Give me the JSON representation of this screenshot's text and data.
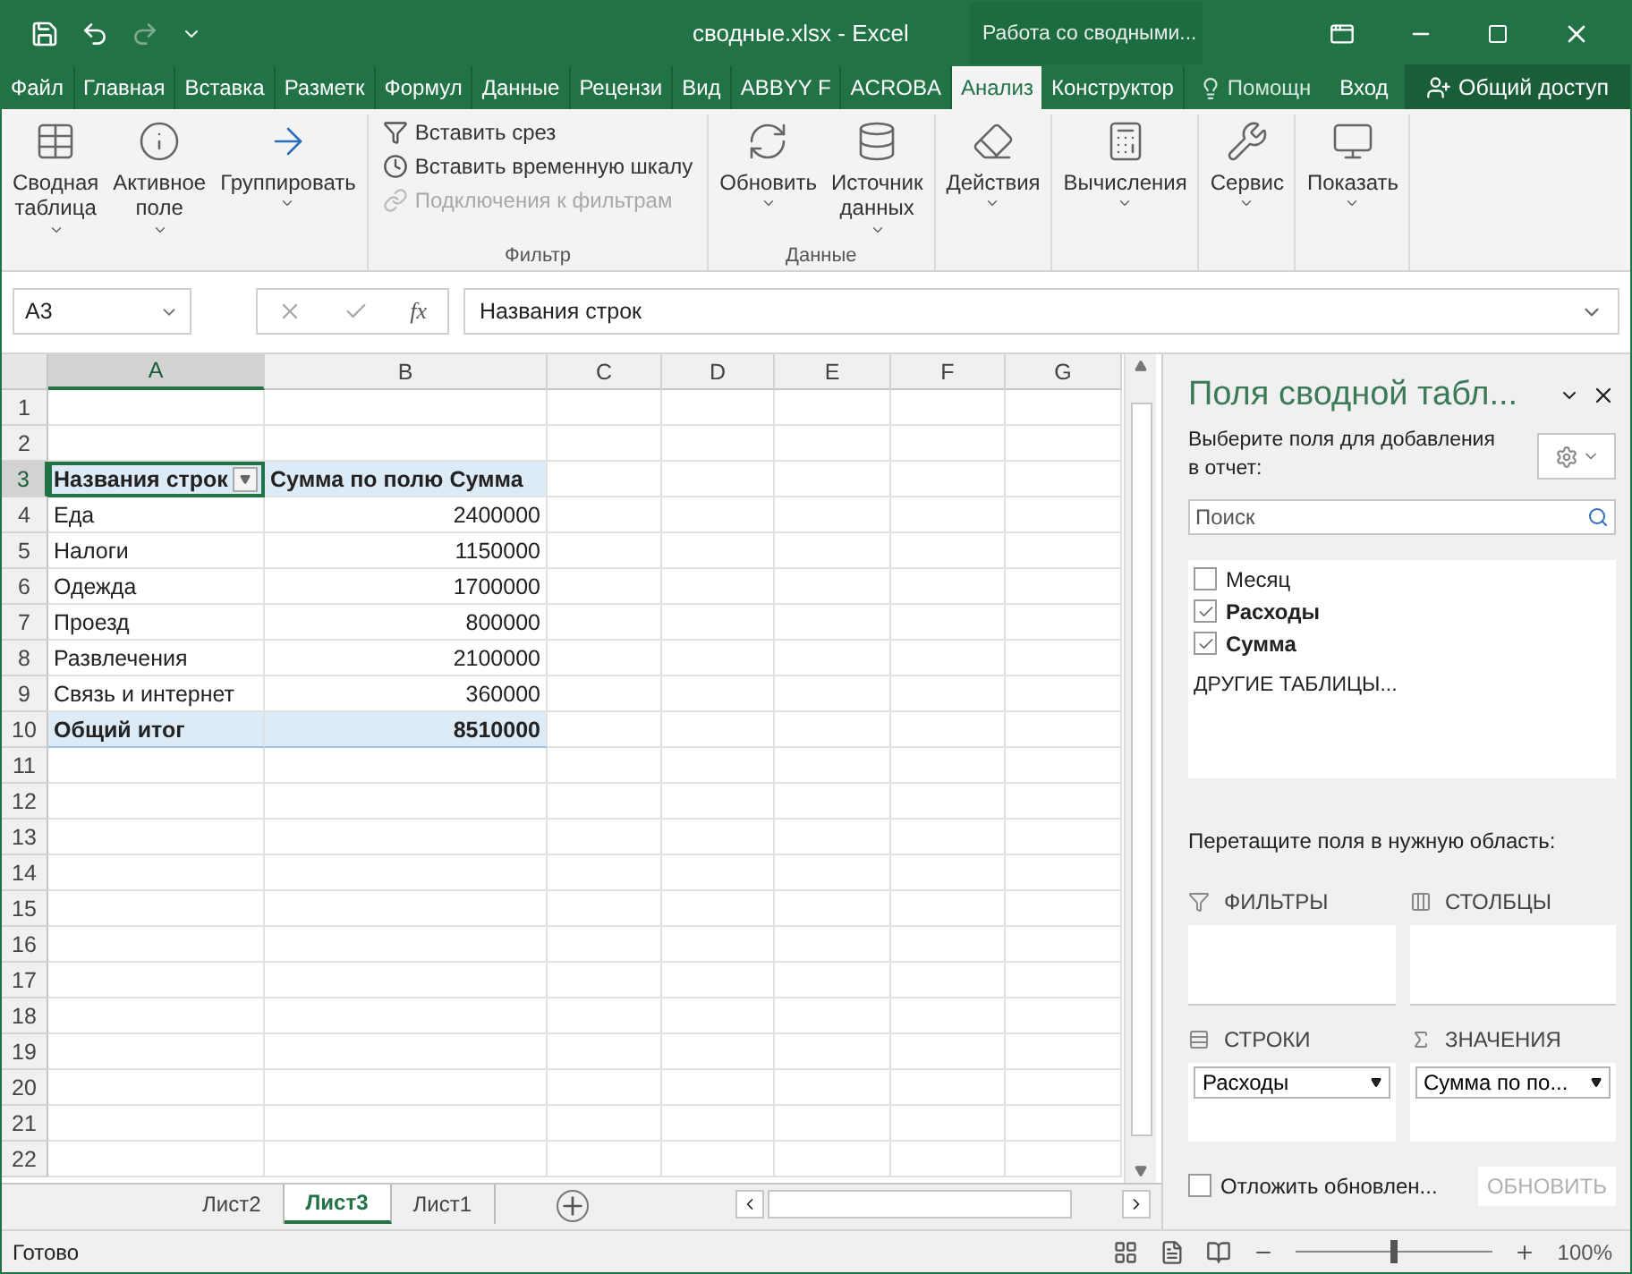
{
  "title_bar": {
    "file_title": "сводные.xlsx - Excel",
    "context_title": "Работа со сводными..."
  },
  "ribbon_tabs": [
    {
      "label": "Файл",
      "selected": false
    },
    {
      "label": "Главная",
      "selected": false
    },
    {
      "label": "Вставка",
      "selected": false
    },
    {
      "label": "Разметк",
      "selected": false
    },
    {
      "label": "Формул",
      "selected": false
    },
    {
      "label": "Данные",
      "selected": false
    },
    {
      "label": "Рецензи",
      "selected": false
    },
    {
      "label": "Вид",
      "selected": false
    },
    {
      "label": "ABBYY F",
      "selected": false
    },
    {
      "label": "ACROBA",
      "selected": false
    },
    {
      "label": "Анализ",
      "selected": true
    },
    {
      "label": "Конструктор",
      "selected": false
    }
  ],
  "tell_me": "Помощн",
  "sign_in": "Вход",
  "share": "Общий доступ",
  "ribbon_groups": [
    {
      "buttons": [
        {
          "label": "Сводная таблица",
          "kind": "large"
        },
        {
          "label": "Активное поле",
          "kind": "large"
        },
        {
          "label": "Группировать",
          "kind": "large"
        }
      ]
    },
    {
      "label": "Фильтр",
      "buttons": [
        {
          "label": "Вставить срез",
          "kind": "small",
          "disabled": false
        },
        {
          "label": "Вставить временную шкалу",
          "kind": "small",
          "disabled": false
        },
        {
          "label": "Подключения к фильтрам",
          "kind": "small",
          "disabled": true
        }
      ]
    },
    {
      "label": "Данные",
      "buttons": [
        {
          "label": "Обновить",
          "kind": "large"
        },
        {
          "label": "Источник данных",
          "kind": "large"
        }
      ]
    },
    {
      "buttons": [
        {
          "label": "Действия",
          "kind": "large"
        }
      ]
    },
    {
      "buttons": [
        {
          "label": "Вычисления",
          "kind": "large"
        }
      ]
    },
    {
      "buttons": [
        {
          "label": "Сервис",
          "kind": "large"
        }
      ]
    },
    {
      "buttons": [
        {
          "label": "Показать",
          "kind": "large"
        }
      ]
    }
  ],
  "name_box": "A3",
  "function_label": "fx",
  "formula": "Названия строк",
  "columns": [
    {
      "label": "A",
      "selected": true
    },
    {
      "label": "B",
      "selected": false
    },
    {
      "label": "C",
      "selected": false
    },
    {
      "label": "D",
      "selected": false
    },
    {
      "label": "E",
      "selected": false
    },
    {
      "label": "F",
      "selected": false
    },
    {
      "label": "G",
      "selected": false
    }
  ],
  "rows": [
    {
      "number": "1",
      "kind": "empty",
      "selected": false
    },
    {
      "number": "2",
      "kind": "empty",
      "selected": false
    },
    {
      "number": "3",
      "kind": "pivot_header",
      "selected": true,
      "label": "Названия строк",
      "value": "Сумма по полю Сумма"
    },
    {
      "number": "4",
      "kind": "item",
      "selected": false,
      "label": "Еда",
      "value": "2400000"
    },
    {
      "number": "5",
      "kind": "item",
      "selected": false,
      "label": "Налоги",
      "value": "1150000"
    },
    {
      "number": "6",
      "kind": "item",
      "selected": false,
      "label": "Одежда",
      "value": "1700000"
    },
    {
      "number": "7",
      "kind": "item",
      "selected": false,
      "label": "Проезд",
      "value": "800000"
    },
    {
      "number": "8",
      "kind": "item",
      "selected": false,
      "label": "Развлечения",
      "value": "2100000"
    },
    {
      "number": "9",
      "kind": "item",
      "selected": false,
      "label": "Связь и интернет",
      "value": "360000"
    },
    {
      "number": "10",
      "kind": "total",
      "selected": false,
      "label": "Общий итог",
      "value": "8510000"
    },
    {
      "number": "11",
      "kind": "empty",
      "selected": false
    },
    {
      "number": "12",
      "kind": "empty",
      "selected": false
    },
    {
      "number": "13",
      "kind": "empty",
      "selected": false
    },
    {
      "number": "14",
      "kind": "empty",
      "selected": false
    },
    {
      "number": "15",
      "kind": "empty",
      "selected": false
    },
    {
      "number": "16",
      "kind": "empty",
      "selected": false
    },
    {
      "number": "17",
      "kind": "empty",
      "selected": false
    },
    {
      "number": "18",
      "kind": "empty",
      "selected": false
    },
    {
      "number": "19",
      "kind": "empty",
      "selected": false
    },
    {
      "number": "20",
      "kind": "empty",
      "selected": false
    },
    {
      "number": "21",
      "kind": "empty",
      "selected": false
    },
    {
      "number": "22",
      "kind": "empty",
      "selected": false
    }
  ],
  "sheet_tabs": [
    {
      "label": "Лист2",
      "selected": false
    },
    {
      "label": "Лист3",
      "selected": true
    },
    {
      "label": "Лист1",
      "selected": false
    }
  ],
  "pane": {
    "title": "Поля сводной табл...",
    "instruction": "Выберите поля для добавления в отчет:",
    "search": {
      "placeholder": "Поиск"
    },
    "fields": [
      {
        "label": "Месяц",
        "checked": false
      },
      {
        "label": "Расходы",
        "checked": true
      },
      {
        "label": "Сумма",
        "checked": true
      }
    ],
    "more_tables": "ДРУГИЕ ТАБЛИЦЫ...",
    "drag_hint": "Перетащите поля в нужную область:",
    "areas": [
      {
        "kind": "filters",
        "label": "ФИЛЬТРЫ"
      },
      {
        "kind": "columns",
        "label": "СТОЛБЦЫ"
      },
      {
        "kind": "rows",
        "label": "СТРОКИ",
        "items": [
          "Расходы"
        ]
      },
      {
        "kind": "values",
        "label": "ЗНАЧЕНИЯ",
        "items": [
          "Сумма по по..."
        ]
      }
    ],
    "defer": {
      "label": "Отложить обновлен...",
      "checked": false
    },
    "update_button": {
      "label": "ОБНОВИТЬ",
      "disabled": true
    }
  },
  "status_bar": {
    "text": "Готово",
    "zoom": "100%",
    "level": 0.5
  }
}
